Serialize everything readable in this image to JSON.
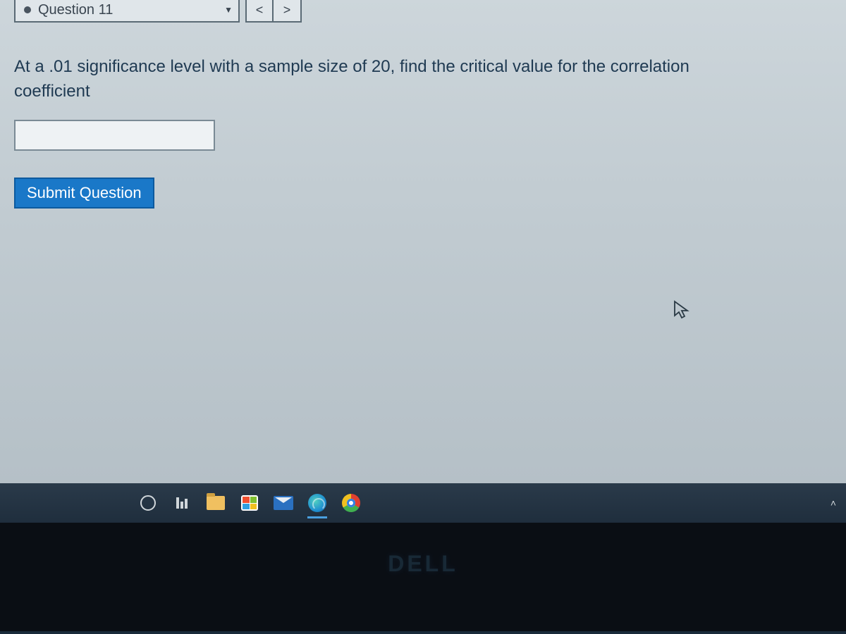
{
  "nav": {
    "dropdown_label": "Question 11",
    "prev_symbol": "<",
    "next_symbol": ">"
  },
  "question": {
    "text": "At a .01 significance level with a sample size of 20, find the critical value for the correlation coefficient",
    "answer_value": ""
  },
  "buttons": {
    "submit_label": "Submit Question"
  },
  "bezel": {
    "brand": "DELL"
  }
}
